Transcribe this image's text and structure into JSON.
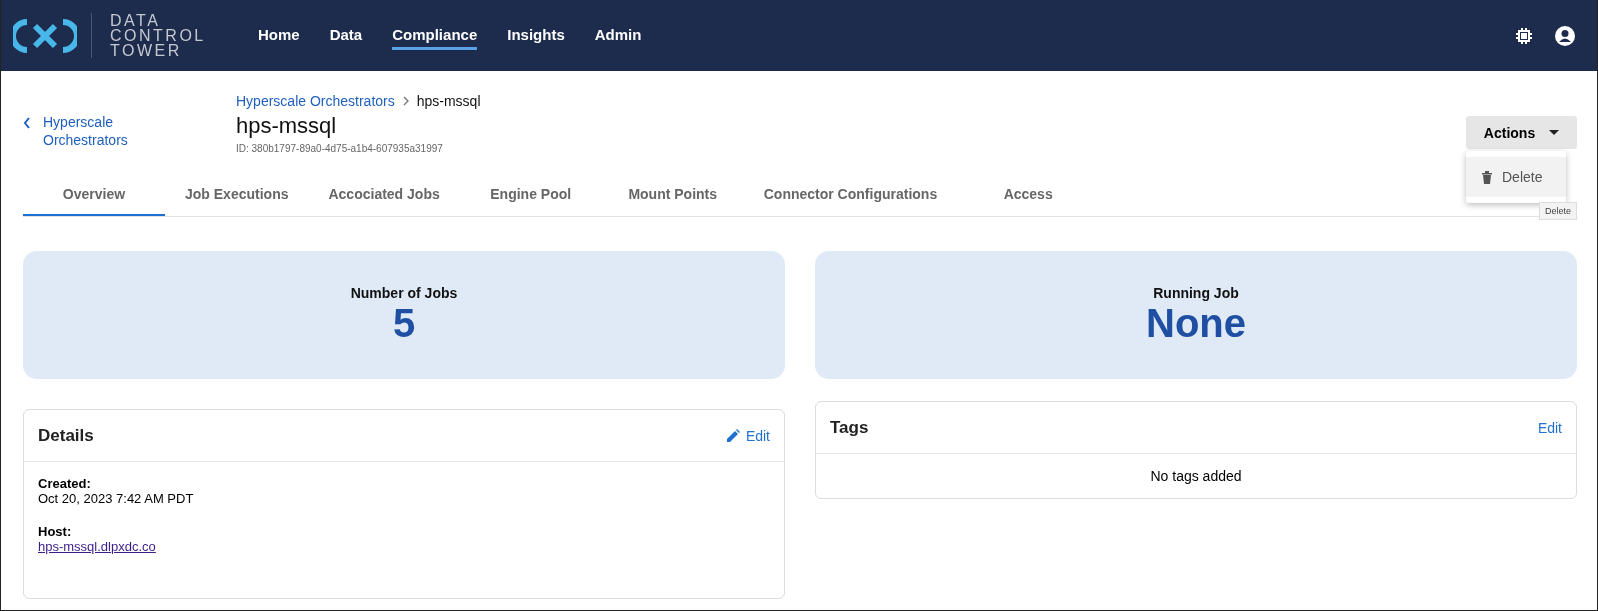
{
  "brand": {
    "lines": [
      "DATA",
      "CONTROL",
      "TOWER"
    ]
  },
  "nav": [
    {
      "label": "Home",
      "selected": false
    },
    {
      "label": "Data",
      "selected": false
    },
    {
      "label": "Compliance",
      "selected": true
    },
    {
      "label": "Insights",
      "selected": false
    },
    {
      "label": "Admin",
      "selected": false
    }
  ],
  "back_link": "Hyperscale Orchestrators",
  "breadcrumb": {
    "parent": "Hyperscale Orchestrators",
    "current": "hps-mssql"
  },
  "title": "hps-mssql",
  "id_text": "ID: 380b1797-89a0-4d75-a1b4-607935a31997",
  "actions": {
    "label": "Actions",
    "expanded": true,
    "menu": [
      {
        "label": "Delete",
        "hovered": true
      }
    ],
    "tooltip": "Delete"
  },
  "tabs": [
    {
      "label": "Overview",
      "selected": true
    },
    {
      "label": "Job Executions",
      "selected": false
    },
    {
      "label": "Accociated Jobs",
      "selected": false
    },
    {
      "label": "Engine Pool",
      "selected": false
    },
    {
      "label": "Mount Points",
      "selected": false
    },
    {
      "label": "Connector Configurations",
      "selected": false
    },
    {
      "label": "Access",
      "selected": false
    }
  ],
  "stats": [
    {
      "label": "Number of Jobs",
      "value": "5"
    },
    {
      "label": "Running Job",
      "value": "None"
    }
  ],
  "details": {
    "title": "Details",
    "edit": "Edit",
    "fields": [
      {
        "label": "Created:",
        "value": "Oct 20, 2023 7:42 AM PDT",
        "kind": "text"
      },
      {
        "label": "Host:",
        "value": "hps-mssql.dlpxdc.co",
        "kind": "link"
      }
    ]
  },
  "tags": {
    "title": "Tags",
    "edit": "Edit",
    "empty": "No tags added"
  }
}
